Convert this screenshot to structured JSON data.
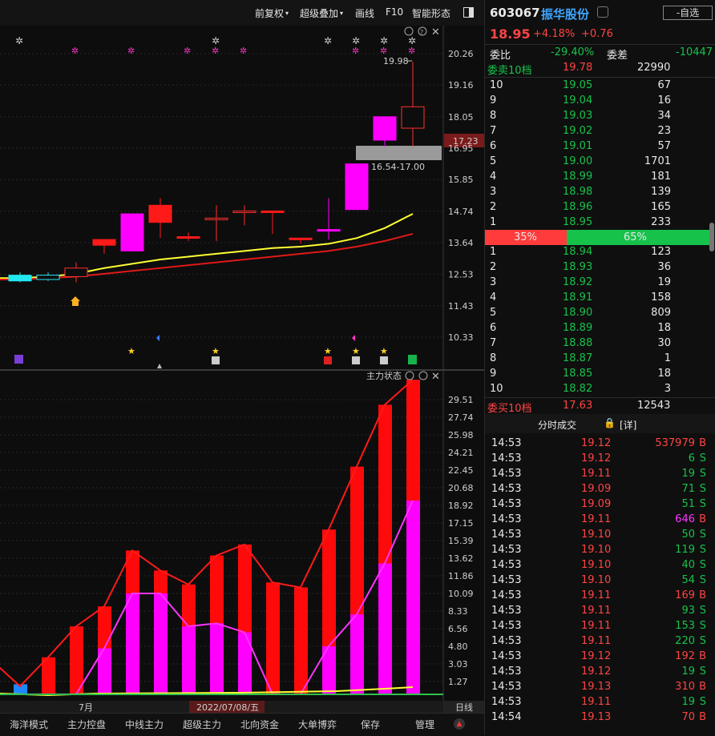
{
  "toolbar": {
    "items": [
      "前复权",
      "超级叠加",
      "画线",
      "F10",
      "智能形态"
    ]
  },
  "price_chart": {
    "y_ticks": [
      "20.26",
      "19.16",
      "18.05",
      "16.95",
      "15.85",
      "14.74",
      "13.64",
      "12.53",
      "11.43",
      "10.33"
    ],
    "current_price_label": "17.23",
    "high_label": "19.98",
    "range_label": "16.54-17.00"
  },
  "indicator_chart": {
    "title": "主力状态",
    "y_ticks": [
      "29.51",
      "27.74",
      "25.98",
      "24.21",
      "22.45",
      "20.68",
      "18.92",
      "17.15",
      "15.39",
      "13.62",
      "11.86",
      "10.09",
      "8.33",
      "6.56",
      "4.80",
      "3.03",
      "1.27"
    ]
  },
  "x_axis": {
    "month_label": "7月",
    "date_label": "2022/07/08/五",
    "period_button": "日线"
  },
  "bottom_tabs": [
    "海洋模式",
    "主力控盘",
    "中线主力",
    "超级主力",
    "北向资金",
    "大单博弈",
    "保存",
    "管理"
  ],
  "stock": {
    "code": "603067",
    "name": "振华股份",
    "watch_button": "-自选",
    "price": "18.95",
    "change_pct": "+4.18%",
    "change": "+0.76",
    "wei_bi_label": "委比",
    "wei_bi": "-29.40%",
    "wei_cha_label": "委差",
    "wei_cha": "-10447",
    "sell10_label": "委卖10档",
    "sell10_price": "19.78",
    "sell10_vol": "22990",
    "buy10_label": "委买10档",
    "buy10_price": "17.63",
    "buy10_vol": "12543"
  },
  "asks": [
    {
      "level": "10",
      "price": "19.05",
      "vol": "67"
    },
    {
      "level": "9",
      "price": "19.04",
      "vol": "16"
    },
    {
      "level": "8",
      "price": "19.03",
      "vol": "34"
    },
    {
      "level": "7",
      "price": "19.02",
      "vol": "23"
    },
    {
      "level": "6",
      "price": "19.01",
      "vol": "57"
    },
    {
      "level": "5",
      "price": "19.00",
      "vol": "1701"
    },
    {
      "level": "4",
      "price": "18.99",
      "vol": "181"
    },
    {
      "level": "3",
      "price": "18.98",
      "vol": "139"
    },
    {
      "level": "2",
      "price": "18.96",
      "vol": "165"
    },
    {
      "level": "1",
      "price": "18.95",
      "vol": "233"
    }
  ],
  "ratio": {
    "sell": "35%",
    "buy": "65%",
    "sell_frac": 0.35
  },
  "bids": [
    {
      "level": "1",
      "price": "18.94",
      "vol": "123"
    },
    {
      "level": "2",
      "price": "18.93",
      "vol": "36"
    },
    {
      "level": "3",
      "price": "18.92",
      "vol": "19"
    },
    {
      "level": "4",
      "price": "18.91",
      "vol": "158"
    },
    {
      "level": "5",
      "price": "18.90",
      "vol": "809"
    },
    {
      "level": "6",
      "price": "18.89",
      "vol": "18"
    },
    {
      "level": "7",
      "price": "18.88",
      "vol": "30"
    },
    {
      "level": "8",
      "price": "18.87",
      "vol": "1"
    },
    {
      "level": "9",
      "price": "18.85",
      "vol": "18"
    },
    {
      "level": "10",
      "price": "18.82",
      "vol": "3"
    }
  ],
  "ticks_header": {
    "title": "分时成交",
    "detail": "[详]"
  },
  "ticks": [
    {
      "time": "14:53",
      "price": "19.12",
      "vol": "537979",
      "side": "B"
    },
    {
      "time": "14:53",
      "price": "19.12",
      "vol": "6",
      "side": "S"
    },
    {
      "time": "14:53",
      "price": "19.11",
      "vol": "19",
      "side": "S"
    },
    {
      "time": "14:53",
      "price": "19.09",
      "vol": "71",
      "side": "S"
    },
    {
      "time": "14:53",
      "price": "19.09",
      "vol": "51",
      "side": "S"
    },
    {
      "time": "14:53",
      "price": "19.11",
      "vol": "646",
      "side": "B"
    },
    {
      "time": "14:53",
      "price": "19.10",
      "vol": "50",
      "side": "S"
    },
    {
      "time": "14:53",
      "price": "19.10",
      "vol": "119",
      "side": "S"
    },
    {
      "time": "14:53",
      "price": "19.10",
      "vol": "40",
      "side": "S"
    },
    {
      "time": "14:53",
      "price": "19.10",
      "vol": "54",
      "side": "S"
    },
    {
      "time": "14:53",
      "price": "19.11",
      "vol": "169",
      "side": "B"
    },
    {
      "time": "14:53",
      "price": "19.11",
      "vol": "93",
      "side": "S"
    },
    {
      "time": "14:53",
      "price": "19.11",
      "vol": "153",
      "side": "S"
    },
    {
      "time": "14:53",
      "price": "19.11",
      "vol": "220",
      "side": "S"
    },
    {
      "time": "14:53",
      "price": "19.12",
      "vol": "192",
      "side": "B"
    },
    {
      "time": "14:53",
      "price": "19.12",
      "vol": "19",
      "side": "S"
    },
    {
      "time": "14:53",
      "price": "19.13",
      "vol": "310",
      "side": "B"
    },
    {
      "time": "14:53",
      "price": "19.11",
      "vol": "19",
      "side": "S"
    },
    {
      "time": "14:54",
      "price": "19.13",
      "vol": "70",
      "side": "B"
    }
  ],
  "colors": {
    "up": "#ff2222",
    "down": "#17c24b",
    "cyan": "#2ff",
    "magenta": "#ff00ff",
    "yellow": "#ffff33"
  },
  "chart_data": [
    {
      "type": "candlestick",
      "title": "",
      "candles": [
        {
          "open": 12.5,
          "close": 12.3,
          "high": 12.6,
          "low": 12.25,
          "color": "cyan"
        },
        {
          "open": 12.35,
          "close": 12.5,
          "high": 12.6,
          "low": 12.3,
          "color": "cyan-hollow"
        },
        {
          "open": 12.45,
          "close": 12.75,
          "high": 12.95,
          "low": 12.25,
          "color": "red-hollow"
        },
        {
          "open": 13.55,
          "close": 13.75,
          "high": 13.75,
          "low": 13.25,
          "color": "red"
        },
        {
          "open": 13.35,
          "close": 14.65,
          "high": 14.65,
          "low": 13.35,
          "color": "magenta"
        },
        {
          "open": 14.95,
          "close": 14.35,
          "high": 15.2,
          "low": 13.8,
          "color": "red"
        },
        {
          "open": 13.85,
          "close": 13.85,
          "high": 14.0,
          "low": 13.7,
          "color": "red"
        },
        {
          "open": 14.5,
          "close": 14.5,
          "high": 14.95,
          "low": 13.7,
          "color": "red-hollow"
        },
        {
          "open": 14.75,
          "close": 14.75,
          "high": 14.95,
          "low": 14.25,
          "color": "red-hollow"
        },
        {
          "open": 14.75,
          "close": 14.75,
          "high": 14.75,
          "low": 13.95,
          "color": "red"
        },
        {
          "open": 13.8,
          "close": 13.8,
          "high": 13.8,
          "low": 13.6,
          "color": "red"
        },
        {
          "open": 14.1,
          "close": 14.1,
          "high": 15.2,
          "low": 13.75,
          "color": "magenta"
        },
        {
          "open": 14.8,
          "close": 16.4,
          "high": 16.4,
          "low": 14.8,
          "color": "magenta"
        },
        {
          "open": 17.23,
          "close": 18.05,
          "high": 18.05,
          "low": 17.0,
          "color": "magenta"
        },
        {
          "open": 17.65,
          "close": 18.4,
          "high": 19.98,
          "low": 17.0,
          "color": "red-hollow"
        }
      ],
      "ma_series": [
        {
          "color": "yellow",
          "values": [
            12.4,
            12.45,
            12.55,
            12.75,
            12.9,
            13.05,
            13.15,
            13.25,
            13.35,
            13.45,
            13.5,
            13.6,
            13.8,
            14.15,
            14.65
          ]
        },
        {
          "color": "red",
          "values": [
            12.35,
            12.4,
            12.45,
            12.55,
            12.65,
            12.75,
            12.85,
            12.95,
            13.05,
            13.15,
            13.25,
            13.35,
            13.5,
            13.7,
            13.95
          ]
        }
      ]
    },
    {
      "type": "bar",
      "title": "主力状态",
      "categories": [
        "1",
        "2",
        "3",
        "4",
        "5",
        "6",
        "7",
        "8",
        "9",
        "10",
        "11",
        "12",
        "13",
        "14",
        "15"
      ],
      "series": [
        {
          "values": [
            0.8,
            3.7,
            6.8,
            8.8,
            14.4,
            12.4,
            11.0,
            13.9,
            15.0,
            11.2,
            10.7,
            16.5,
            22.8,
            29.0,
            31.5
          ]
        },
        {
          "values": [
            0.0,
            0.0,
            0.0,
            4.6,
            10.1,
            10.1,
            6.8,
            7.1,
            6.2,
            0.0,
            0.0,
            4.8,
            8.0,
            13.1,
            19.4
          ]
        }
      ]
    }
  ]
}
